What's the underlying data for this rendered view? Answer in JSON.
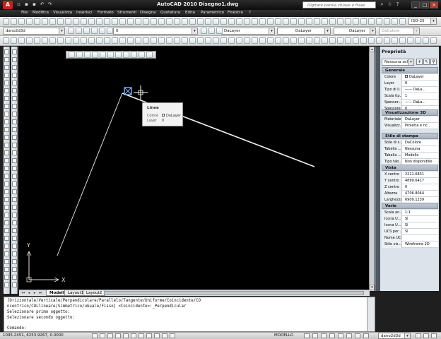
{
  "titlebar": {
    "logo": "A",
    "title": "AutoCAD 2010   Disegno1.dwg",
    "search_placeholder": "Digitare parola chiave o frase",
    "minimize": "_",
    "maximize": "□",
    "close": "×"
  },
  "menu": {
    "items": [
      "File",
      "Modifica",
      "Visualizza",
      "Inserisci",
      "Formato",
      "Strumenti",
      "Disegna",
      "Quotatura",
      "Edita",
      "Parametrico",
      "Finestra",
      "?"
    ]
  },
  "toolbar": {
    "workspace_combo": "dano2d3d",
    "layer_combo": "0",
    "style_combo": "ISO-25",
    "color_combo": "DaLayer",
    "linetype_combo": "DaLayer",
    "lineweight_combo": "DaLayer",
    "plotstyle_combo": "DaColore"
  },
  "tooltip": {
    "title": "Linea",
    "color_label": "Colore",
    "color_value": "DaLayer",
    "layer_label": "Layer",
    "layer_value": "0"
  },
  "tabs": [
    "Modello",
    "Layout1",
    "Layout2"
  ],
  "ucs": {
    "x_label": "X",
    "y_label": "Y"
  },
  "properties": {
    "title": "Proprietà",
    "selection": "Nessuna sele",
    "sections": {
      "generale": {
        "label": "Generale",
        "rows": [
          {
            "key": "Colore",
            "value": "DaLayer"
          },
          {
            "key": "Layer",
            "value": "0"
          },
          {
            "key": "Tipo di li...",
            "value": "—— DaLa..."
          },
          {
            "key": "Scala tip...",
            "value": "1"
          },
          {
            "key": "Spessor...",
            "value": "—— DaLa..."
          },
          {
            "key": "Spessore",
            "value": "0"
          }
        ]
      },
      "visualizzazione3d": {
        "label": "Visualizzazione 3D",
        "rows": [
          {
            "key": "Materiale",
            "value": "DaLayer"
          },
          {
            "key": "Visualizz...",
            "value": "Proietta e ric..."
          }
        ]
      },
      "stampa": {
        "label": "Stile di stampa",
        "rows": [
          {
            "key": "Stile di s...",
            "value": "DaColore"
          },
          {
            "key": "Tabella ...",
            "value": "Nessuna"
          },
          {
            "key": "Tabella ...",
            "value": "Modello"
          },
          {
            "key": "Tipo tab...",
            "value": "Non disponibile"
          }
        ]
      },
      "vista": {
        "label": "Vista",
        "rows": [
          {
            "key": "X centro",
            "value": "2211.6831"
          },
          {
            "key": "Y centro",
            "value": "4899.6417"
          },
          {
            "key": "Z centro",
            "value": "0"
          },
          {
            "key": "Altezza",
            "value": "4706.8044"
          },
          {
            "key": "Larghezza",
            "value": "6909.1239"
          }
        ]
      },
      "varie": {
        "label": "Varie",
        "rows": [
          {
            "key": "Scala an...",
            "value": "1:1"
          },
          {
            "key": "Icona U...",
            "value": "Sì"
          },
          {
            "key": "Icona U...",
            "value": "Sì"
          },
          {
            "key": "UCS per ...",
            "value": "Sì"
          },
          {
            "key": "Nome UCS",
            "value": ""
          },
          {
            "key": "Stile vis...",
            "value": "Wireframe 2D"
          }
        ]
      }
    }
  },
  "command": {
    "lines": [
      "[Orizzontale/Verticale/Perpendicolare/Parallelo/Tangente/Uniforme/Coincidente/CO",
      "ncentrico/COLlineare/Simmetrico/uGuale/Fisso] <Coincidente>:_Perpendicular",
      "Selezionare primo oggetto:",
      "Selezionare secondo oggetto:",
      "",
      "Comando:"
    ]
  },
  "status": {
    "coords": "1095.2451, 6253.9267, 0.0000",
    "model": "MODELLO",
    "workspace": "dano2d3d"
  }
}
